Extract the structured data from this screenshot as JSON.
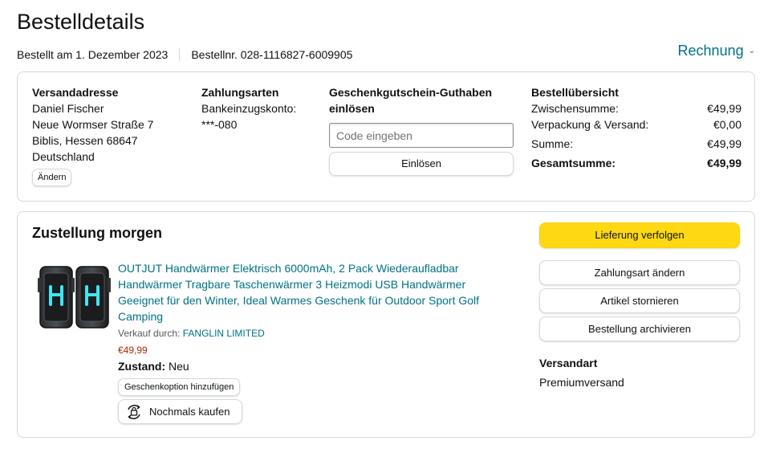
{
  "header": {
    "title": "Bestelldetails",
    "order_date": "Bestellt am 1. Dezember 2023",
    "order_number": "Bestellnr. 028-1116827-6009905",
    "invoice_label": "Rechnung"
  },
  "shipping_address": {
    "heading": "Versandadresse",
    "lines": [
      "Daniel Fischer",
      "Neue Wormser Straße 7",
      "Biblis, Hessen 68647",
      "Deutschland"
    ],
    "change_label": "Ändern"
  },
  "payment": {
    "heading": "Zahlungsarten",
    "method": "Bankeinzugskonto:",
    "account": "***-080"
  },
  "gift_card": {
    "heading": "Geschenkgutschein-Guthaben einlösen",
    "placeholder": "Code eingeben",
    "redeem_label": "Einlösen"
  },
  "summary": {
    "heading": "Bestellübersicht",
    "rows": [
      {
        "label": "Zwischensumme:",
        "value": "€49,99"
      },
      {
        "label": "Verpackung & Versand:",
        "value": "€0,00"
      },
      {
        "label": "Summe:",
        "value": "€49,99"
      }
    ],
    "total": {
      "label": "Gesamtsumme:",
      "value": "€49,99"
    }
  },
  "delivery": {
    "title": "Zustellung morgen",
    "product": {
      "title": "OUTJUT Handwärmer Elektrisch 6000mAh, 2 Pack Wiederaufladbar Handwärmer Tragbare Taschenwärmer 3 Heizmodi USB Handwärmer Geeignet für den Winter, Ideal Warmes Geschenk für Outdoor Sport Golf Camping",
      "seller_prefix": "Verkauf durch:",
      "seller": "FANGLIN LIMITED",
      "price": "€49,99",
      "condition_label": "Zustand:",
      "condition": "Neu",
      "gift_option_label": "Geschenkoption hinzufügen",
      "buy_again_label": "Nochmals kaufen"
    },
    "actions": {
      "track": "Lieferung verfolgen",
      "change_payment": "Zahlungsart ändern",
      "cancel": "Artikel stornieren",
      "archive": "Bestellung archivieren"
    },
    "shipping_method_label": "Versandart",
    "shipping_method": "Premiumversand"
  },
  "colors": {
    "link": "#007185",
    "price": "#b12704",
    "primary_button": "#ffd814",
    "border": "#d5d9d9",
    "product_glow": "#3ee6f0"
  },
  "icons": {
    "invoice_chevron": "chevron-down-icon",
    "buy_again": "buy-again-icon"
  }
}
